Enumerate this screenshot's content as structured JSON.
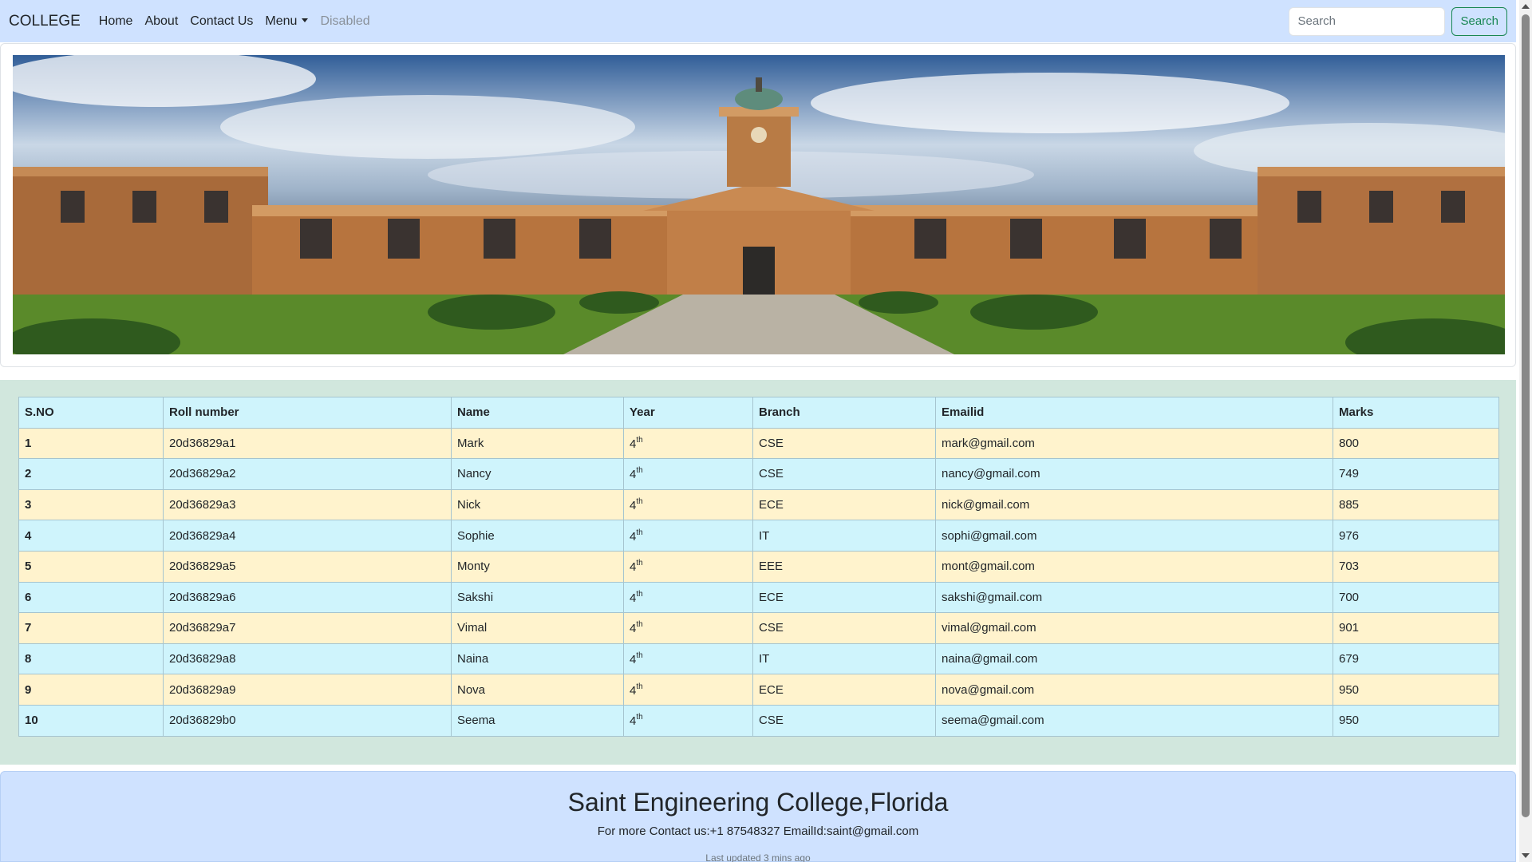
{
  "navbar": {
    "brand": "COLLEGE",
    "links": [
      "Home",
      "About",
      "Contact Us"
    ],
    "menu_label": "Menu",
    "disabled_label": "Disabled",
    "search_placeholder": "Search",
    "search_button": "Search"
  },
  "hero": {
    "image": "college-building-photo",
    "colors": {
      "sky": "#315e98",
      "building": "#b7743e",
      "grass": "#5a8a2a"
    }
  },
  "table": {
    "headers": [
      "S.NO",
      "Roll number",
      "Name",
      "Year",
      "Branch",
      "Emailid",
      "Marks"
    ],
    "rows": [
      [
        "1",
        "20d36829a1",
        "Mark",
        "4",
        "th",
        "CSE",
        "mark@gmail.com",
        "800"
      ],
      [
        "2",
        "20d36829a2",
        "Nancy",
        "4",
        "th",
        "CSE",
        "nancy@gmail.com",
        "749"
      ],
      [
        "3",
        "20d36829a3",
        "Nick",
        "4",
        "th",
        "ECE",
        "nick@gmail.com",
        "885"
      ],
      [
        "4",
        "20d36829a4",
        "Sophie",
        "4",
        "th",
        "IT",
        "sophi@gmail.com",
        "976"
      ],
      [
        "5",
        "20d36829a5",
        "Monty",
        "4",
        "th",
        "EEE",
        "mont@gmail.com",
        "703"
      ],
      [
        "6",
        "20d36829a6",
        "Sakshi",
        "4",
        "th",
        "ECE",
        "sakshi@gmail.com",
        "700"
      ],
      [
        "7",
        "20d36829a7",
        "Vimal",
        "4",
        "th",
        "CSE",
        "vimal@gmail.com",
        "901"
      ],
      [
        "8",
        "20d36829a8",
        "Naina",
        "4",
        "th",
        "IT",
        "naina@gmail.com",
        "679"
      ],
      [
        "9",
        "20d36829a9",
        "Nova",
        "4",
        "th",
        "ECE",
        "nova@gmail.com",
        "950"
      ],
      [
        "10",
        "20d36829b0",
        "Seema",
        "4",
        "th",
        "CSE",
        "seema@gmail.com",
        "950"
      ]
    ],
    "colors": {
      "header": "#cff4fc",
      "row_odd": "#fff3cd",
      "row_even": "#cff4fc",
      "section_bg": "#d1e7dd"
    }
  },
  "footer": {
    "title": "Saint Engineering College,Florida",
    "contact": "For more Contact us:+1 87548327 EmailId:saint@gmail.com",
    "updated": "Last updated 3 mins ago"
  },
  "colors": {
    "navbar_bg": "#cfe2ff",
    "success": "#198754"
  }
}
